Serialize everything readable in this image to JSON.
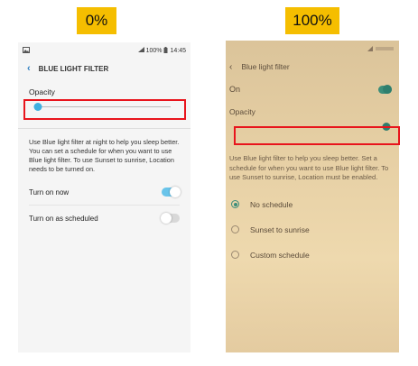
{
  "labels": {
    "left": "0%",
    "right": "100%"
  },
  "left_phone": {
    "status": {
      "battery": "100%",
      "time": "14:45"
    },
    "header": {
      "title": "BLUE LIGHT FILTER"
    },
    "opacity": {
      "label": "Opacity",
      "value_percent": 0
    },
    "description": "Use Blue light filter at night to help you sleep better. You can set a schedule for when you want to use Blue light filter. To use Sunset to sunrise, Location needs to be turned on.",
    "settings": [
      {
        "label": "Turn on now",
        "state": "on"
      },
      {
        "label": "Turn on as scheduled",
        "state": "off"
      }
    ]
  },
  "right_phone": {
    "header": {
      "title": "Blue light filter"
    },
    "on_row": {
      "label": "On",
      "state": "on"
    },
    "opacity": {
      "label": "Opacity",
      "value_percent": 100
    },
    "description": "Use Blue light filter to help you sleep better. Set a schedule for when you want to use Blue light filter. To use Sunset to sunrise, Location must be enabled.",
    "schedule_options": [
      {
        "label": "No schedule",
        "selected": true
      },
      {
        "label": "Sunset to sunrise",
        "selected": false
      },
      {
        "label": "Custom schedule",
        "selected": false
      }
    ]
  },
  "colors": {
    "label_bg": "#f5be00",
    "highlight": "#e8141c",
    "accent_left": "#3fb0e0",
    "accent_right": "#2f7c6c"
  }
}
